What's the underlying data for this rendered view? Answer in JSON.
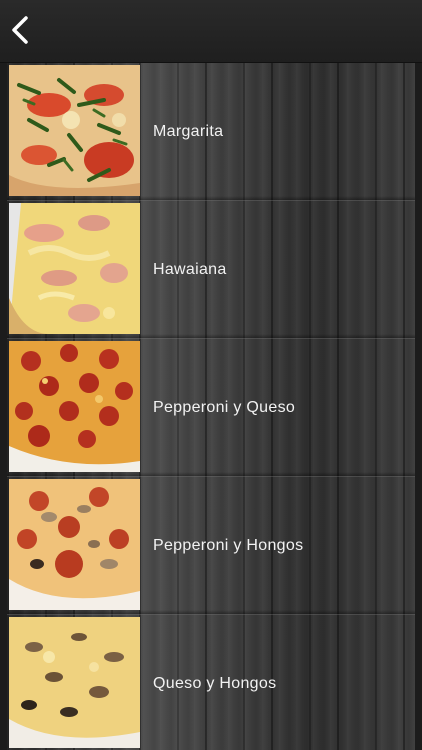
{
  "header": {
    "back_icon": "chevron-left-icon"
  },
  "menu": {
    "items": [
      {
        "label": "Margarita",
        "image_icon": "pizza-margarita-photo"
      },
      {
        "label": "Hawaiana",
        "image_icon": "pizza-hawaiana-photo"
      },
      {
        "label": "Pepperoni y Queso",
        "image_icon": "pizza-pepperoni-queso-photo"
      },
      {
        "label": "Pepperoni y Hongos",
        "image_icon": "pizza-pepperoni-hongos-photo"
      },
      {
        "label": "Queso y Hongos",
        "image_icon": "pizza-queso-hongos-photo"
      }
    ]
  },
  "colors": {
    "header_bg": "#252525",
    "label_text": "#f2f2f2",
    "wood_base": "#3a3a3a"
  }
}
